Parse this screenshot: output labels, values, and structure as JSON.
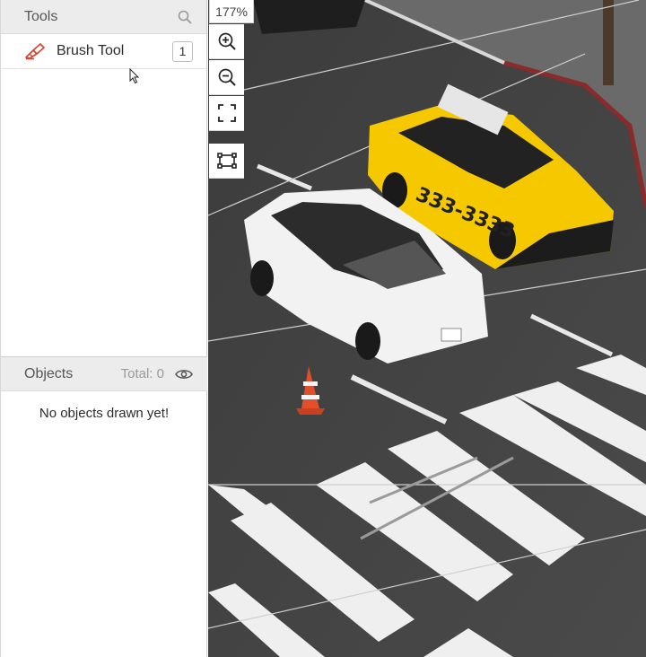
{
  "tools_panel": {
    "title": "Tools",
    "items": [
      {
        "label": "Brush Tool",
        "hotkey": "1",
        "icon": "brush-icon"
      }
    ]
  },
  "objects_panel": {
    "title": "Objects",
    "total_label": "Total: 0",
    "empty_message": "No objects drawn yet!"
  },
  "canvas": {
    "zoom": "177%",
    "controls": [
      "zoom-in-icon",
      "zoom-out-icon",
      "fit-screen-icon",
      "bounding-box-icon"
    ]
  },
  "colors": {
    "brush_accent": "#d9452c",
    "panel_header_bg": "#ececec",
    "taxi_yellow": "#f5c800"
  }
}
